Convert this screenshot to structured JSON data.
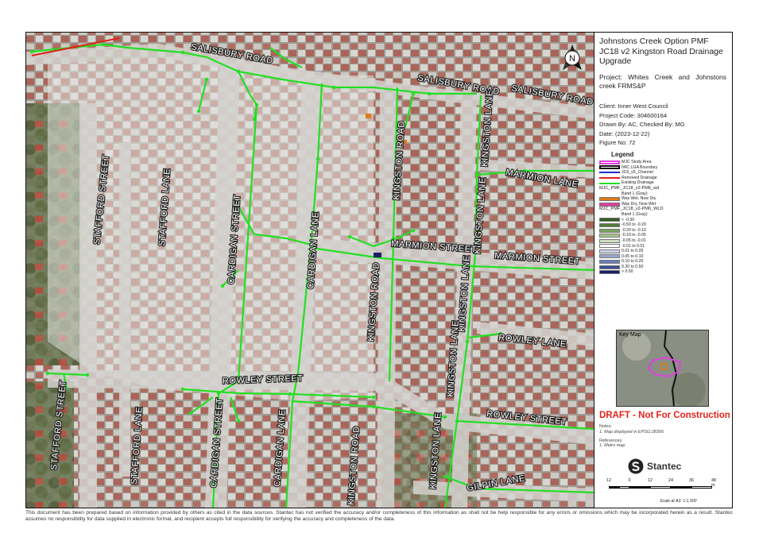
{
  "title": "Johnstons Creek Option PMF JC18 v2 Kingston Road Drainage Upgrade",
  "project": "Project: Whites Creek and Johnstons creek FRMS&P",
  "meta": {
    "client": "Client: Inner West Council",
    "project_code": "Project Code: 304600164",
    "drawn_by": "Drawn By: AC, Checked By: MG",
    "date": "Date: (2023-12-22)",
    "figure_no": "Figure No: 72"
  },
  "legend": {
    "heading": "Legend",
    "items": [
      {
        "label": "MJC Study Area",
        "kind": "box",
        "color": "#e040e0"
      },
      {
        "label": "IWC LGA Boundary",
        "kind": "box",
        "color": "#111111"
      },
      {
        "label": "JC6_v5_Channel",
        "kind": "line",
        "color": "#1a2fd6"
      },
      {
        "label": "Removed Drainage",
        "kind": "line",
        "color": "#e0201a"
      },
      {
        "label": "Existing Drainage",
        "kind": "line",
        "color": "#22e022"
      }
    ],
    "group1": {
      "name": "MJC_PMF_JC18_v2-PM6_wd",
      "band": "Band 1 (Gray)",
      "items": [
        {
          "label": "Was Wet, Now Dry",
          "color": "#e07a14"
        },
        {
          "label": "Was Dry, Now Wet",
          "color": "#e23ca0"
        }
      ]
    },
    "group2": {
      "name": "MJC_PMF_JC18_v2-PM6_WLD",
      "band": "Band 1 (Gray)",
      "items": [
        {
          "label": "< -0.50",
          "color": "#2f5f1e"
        },
        {
          "label": "-0.50 to -0.20",
          "color": "#4f7f36"
        },
        {
          "label": "-0.20 to -0.10",
          "color": "#79a35c"
        },
        {
          "label": "-0.10 to -0.05",
          "color": "#a6c48c"
        },
        {
          "label": "-0.05 to -0.01",
          "color": "#cfe0c2"
        },
        {
          "label": "-0.01 to 0.01",
          "color": "#ffffff"
        },
        {
          "label": "0.01 to 0.05",
          "color": "#c9d2e8"
        },
        {
          "label": "0.05 to 0.10",
          "color": "#98a8cf"
        },
        {
          "label": "0.10 to 0.20",
          "color": "#6a7db5"
        },
        {
          "label": "0.20 to 0.50",
          "color": "#3c4f94"
        },
        {
          "label": "> 0.50",
          "color": "#1a1f6a"
        }
      ]
    }
  },
  "keymap_label": "Key Map",
  "draft": "DRAFT - Not For Construction",
  "notes": {
    "heading": "Notes:",
    "line1": "1. Map displayed in EPSG:28356",
    "ref_heading": "References:",
    "ref1": "1. Metro map"
  },
  "logo": "Stantec",
  "north_letter": "N",
  "scale": {
    "labels": [
      "12",
      "0",
      "12",
      "24",
      "36",
      "48 m"
    ],
    "text": "Scale at A3: 1:1,500"
  },
  "streets": {
    "salisbury_w": "SALISBURY ROAD",
    "salisbury_e1": "SALISBURY ROAD",
    "salisbury_e2": "SALISBURY ROAD",
    "stafford_st_n": "STAFFORD STREET",
    "stafford_st_s": "STAFFORD STREET",
    "stafford_ln_n": "STAFFORD LANE",
    "stafford_ln_s": "STAFFORD LANE",
    "cardigan_st_n": "CARDIGAN STREET",
    "cardigan_st_s": "CARDIGAN STREET",
    "cardigan_ln_n": "CARDIGAN LANE",
    "cardigan_ln_s": "CARDIGAN LANE",
    "kingston_rd_n": "KINGSTON ROAD",
    "kingston_rd_m": "KINGSTON ROAD",
    "kingston_rd_s": "KINGSTON ROAD",
    "kingston_ln_1": "KINGSTON LANE",
    "kingston_ln_2": "KINGSTON LANE",
    "kingston_ln_3": "KINGSTON LANE",
    "kingston_ln_4": "KINGSTON LANE",
    "kingston_ln_5": "KINGSTON LANE",
    "marmion_st_1": "MARMION STREET",
    "marmion_st_2": "MARMION STREET",
    "marmion_ln": "MARMION LANE",
    "rowley_st_1": "ROWLEY STREET",
    "rowley_st_2": "ROWLEY STREET",
    "rowley_ln": "ROWLEY LANE",
    "gilpin_ln": "GILPIN LANE"
  },
  "disclaimer": "This document has been prepared based on information provided by others as cited in the data sources. Stantec has not verified the accuracy and/or completeness of this information as shall not be help responsible for any errors or omissions which may be incorporated herein as a result. Stantec assumes no responsibility for data supplied in electronic format, and recipient accepts full responsibility for verifying the accuracy and completeness of the data."
}
